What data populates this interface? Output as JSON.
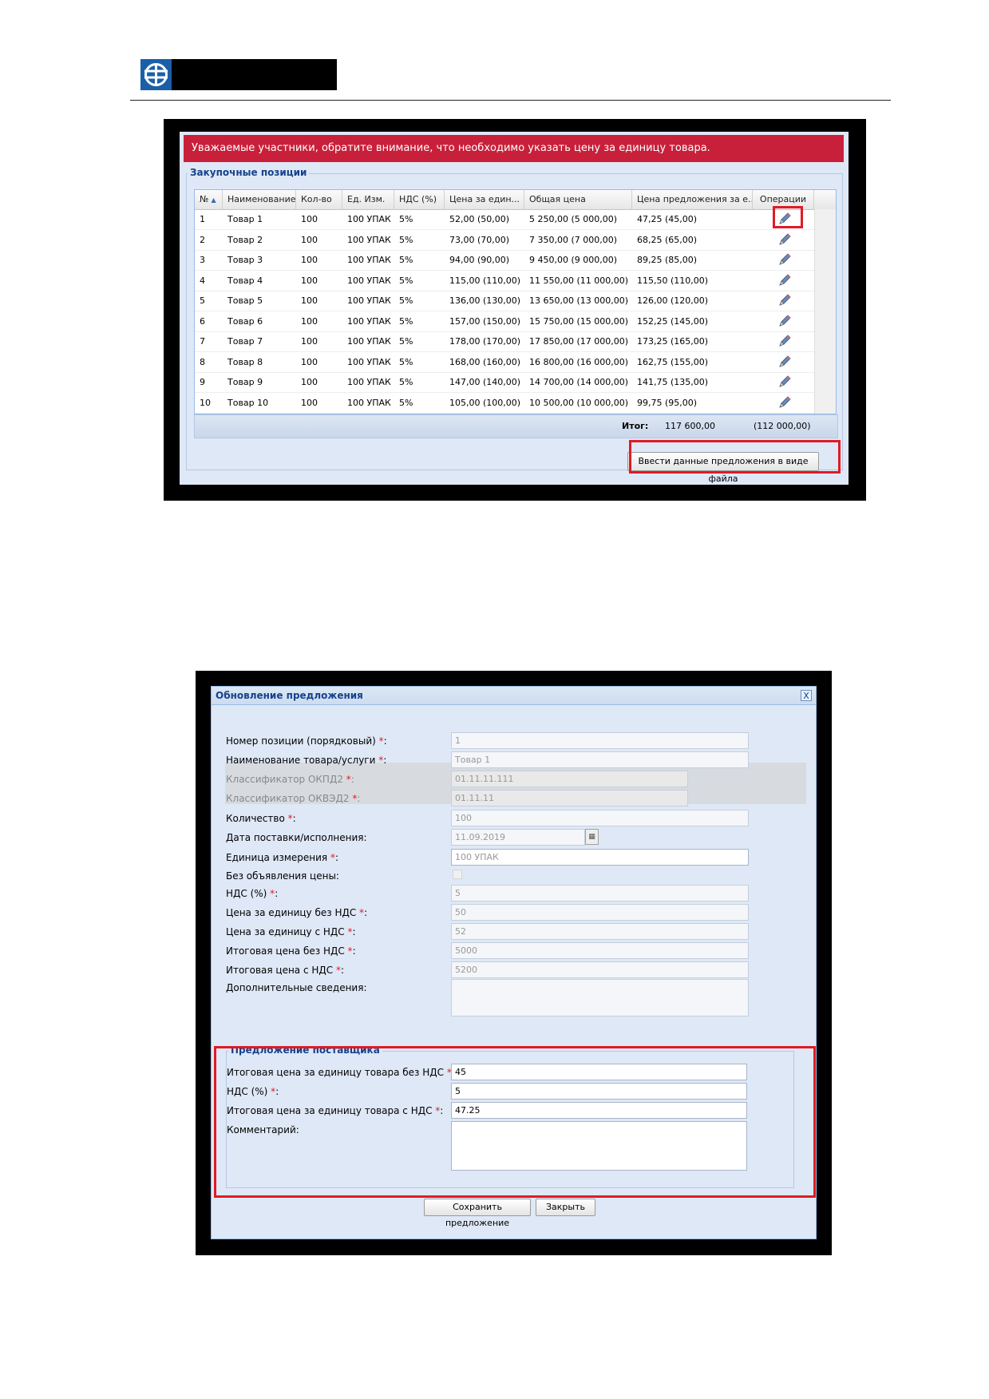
{
  "logo": {
    "icon": "company-logo-icon"
  },
  "grid_screen": {
    "alert": "Уважаемые участники, обратите внимание, что необходимо указать цену за единицу товара.",
    "section_title": "Закупочные позиции",
    "columns": [
      "№",
      "Наименование",
      "Кол-во",
      "Ед. Изм.",
      "НДС (%)",
      "Цена за един...",
      "Общая цена",
      "Цена предложения за е...",
      "Операции"
    ],
    "rows": [
      {
        "n": "1",
        "name": "Товар 1",
        "qty": "100",
        "unit": "100 УПАК",
        "vat": "5%",
        "price": "52,00 (50,00)",
        "total": "5 250,00 (5 000,00)",
        "offer": "47,25 (45,00)"
      },
      {
        "n": "2",
        "name": "Товар 2",
        "qty": "100",
        "unit": "100 УПАК",
        "vat": "5%",
        "price": "73,00 (70,00)",
        "total": "7 350,00 (7 000,00)",
        "offer": "68,25 (65,00)"
      },
      {
        "n": "3",
        "name": "Товар 3",
        "qty": "100",
        "unit": "100 УПАК",
        "vat": "5%",
        "price": "94,00 (90,00)",
        "total": "9 450,00 (9 000,00)",
        "offer": "89,25 (85,00)"
      },
      {
        "n": "4",
        "name": "Товар 4",
        "qty": "100",
        "unit": "100 УПАК",
        "vat": "5%",
        "price": "115,00 (110,00)",
        "total": "11 550,00 (11 000,00)",
        "offer": "115,50 (110,00)"
      },
      {
        "n": "5",
        "name": "Товар 5",
        "qty": "100",
        "unit": "100 УПАК",
        "vat": "5%",
        "price": "136,00 (130,00)",
        "total": "13 650,00 (13 000,00)",
        "offer": "126,00 (120,00)"
      },
      {
        "n": "6",
        "name": "Товар 6",
        "qty": "100",
        "unit": "100 УПАК",
        "vat": "5%",
        "price": "157,00 (150,00)",
        "total": "15 750,00 (15 000,00)",
        "offer": "152,25 (145,00)"
      },
      {
        "n": "7",
        "name": "Товар 7",
        "qty": "100",
        "unit": "100 УПАК",
        "vat": "5%",
        "price": "178,00 (170,00)",
        "total": "17 850,00 (17 000,00)",
        "offer": "173,25 (165,00)"
      },
      {
        "n": "8",
        "name": "Товар 8",
        "qty": "100",
        "unit": "100 УПАК",
        "vat": "5%",
        "price": "168,00 (160,00)",
        "total": "16 800,00 (16 000,00)",
        "offer": "162,75 (155,00)"
      },
      {
        "n": "9",
        "name": "Товар 9",
        "qty": "100",
        "unit": "100 УПАК",
        "vat": "5%",
        "price": "147,00 (140,00)",
        "total": "14 700,00 (14 000,00)",
        "offer": "141,75 (135,00)"
      },
      {
        "n": "10",
        "name": "Товар 10",
        "qty": "100",
        "unit": "100 УПАК",
        "vat": "5%",
        "price": "105,00 (100,00)",
        "total": "10 500,00 (10 000,00)",
        "offer": "99,75 (95,00)"
      }
    ],
    "total_label": "Итог:",
    "total_value": "117 600,00",
    "total_value2": "(112 000,00)",
    "upload_button": "Ввести данные предложения в виде файла",
    "edit_icon": "pencil-icon"
  },
  "dialog": {
    "title": "Обновление предложения",
    "close": "X",
    "fields": [
      {
        "label": "Номер позиции (порядковый)",
        "req": true,
        "value": "1"
      },
      {
        "label": "Наименование товара/услуги",
        "req": true,
        "value": "Товар 1"
      },
      {
        "label": "Классификатор ОКПД2",
        "req": true,
        "value": "01.11.11.111"
      },
      {
        "label": "Классификатор ОКВЭД2",
        "req": true,
        "value": "01.11.11"
      },
      {
        "label": "Количество",
        "req": true,
        "value": "100"
      },
      {
        "label": "Дата поставки/исполнения:",
        "req": false,
        "value": "11.09.2019"
      },
      {
        "label": "Единица измерения",
        "req": true,
        "value": "100 УПАК"
      },
      {
        "label": "Без объявления цены:",
        "req": false,
        "value": ""
      },
      {
        "label": "НДС (%)",
        "req": true,
        "value": "5"
      },
      {
        "label": "Цена за единицу без НДС",
        "req": true,
        "value": "50"
      },
      {
        "label": "Цена за единицу с НДС",
        "req": true,
        "value": "52"
      },
      {
        "label": "Итоговая цена без НДС",
        "req": true,
        "value": "5000"
      },
      {
        "label": "Итоговая цена с НДС",
        "req": true,
        "value": "5200"
      },
      {
        "label": "Дополнительные сведения:",
        "req": false,
        "value": ""
      }
    ],
    "supplier_title": "Предложение поставщика",
    "supplier_fields": [
      {
        "label": "Итоговая цена за единицу товара без НДС",
        "req": true,
        "value": "45"
      },
      {
        "label": "НДС (%)",
        "req": true,
        "value": "5"
      },
      {
        "label": "Итоговая цена за единицу товара с НДС",
        "req": true,
        "value": "47.25"
      },
      {
        "label": "Комментарий:",
        "req": false,
        "value": ""
      }
    ],
    "save_button": "Сохранить предложение",
    "close_button": "Закрыть",
    "req_mark": "*",
    "colon": ":"
  },
  "colors": {
    "accent": "#15428b",
    "alert": "#c8203a",
    "highlight": "#e01b24",
    "panel": "#dfe8f6"
  }
}
